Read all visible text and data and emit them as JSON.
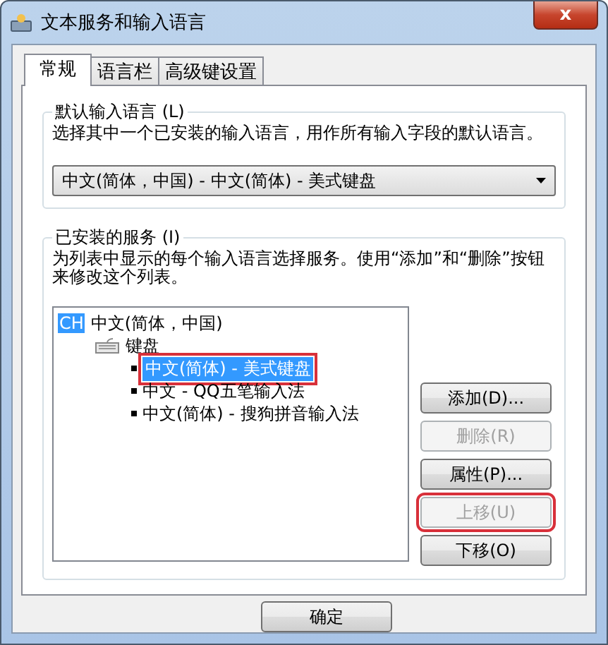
{
  "window": {
    "title": "文本服务和输入语言",
    "close": "x"
  },
  "tabs": [
    {
      "label": "常规",
      "selected": true
    },
    {
      "label": "语言栏",
      "selected": false
    },
    {
      "label": "高级键设置",
      "selected": false
    }
  ],
  "default_language": {
    "legend": "默认输入语言 (L)",
    "description": "选择其中一个已安装的输入语言，用作所有输入字段的默认语言。",
    "dropdown": {
      "value": "中文(简体，中国) - 中文(简体) - 美式键盘"
    }
  },
  "installed_services": {
    "legend": "已安装的服务 (I)",
    "description": "为列表中显示的每个输入语言选择服务。使用“添加”和“删除”按钮来修改这个列表。",
    "tree": [
      {
        "badge": "CH",
        "label": "中文(简体，中国)",
        "children": [
          {
            "label": "键盘",
            "children": [
              {
                "label": "中文(简体) - 美式键盘",
                "selected": true,
                "highlighted": true
              },
              {
                "label": "中文 - QQ五笔输入法",
                "selected": false,
                "highlighted": false
              },
              {
                "label": "中文(简体) - 搜狗拼音输入法",
                "selected": false,
                "highlighted": false
              }
            ]
          }
        ]
      }
    ],
    "buttons": [
      {
        "label": "添加(D)...",
        "disabled": false,
        "highlighted": false
      },
      {
        "label": "删除(R)",
        "disabled": true,
        "highlighted": false
      },
      {
        "label": "属性(P)...",
        "disabled": false,
        "highlighted": false
      },
      {
        "label": "上移(U)",
        "disabled": true,
        "highlighted": true
      },
      {
        "label": "下移(O)",
        "disabled": false,
        "highlighted": false
      }
    ]
  },
  "footer_buttons": [
    "确定"
  ]
}
